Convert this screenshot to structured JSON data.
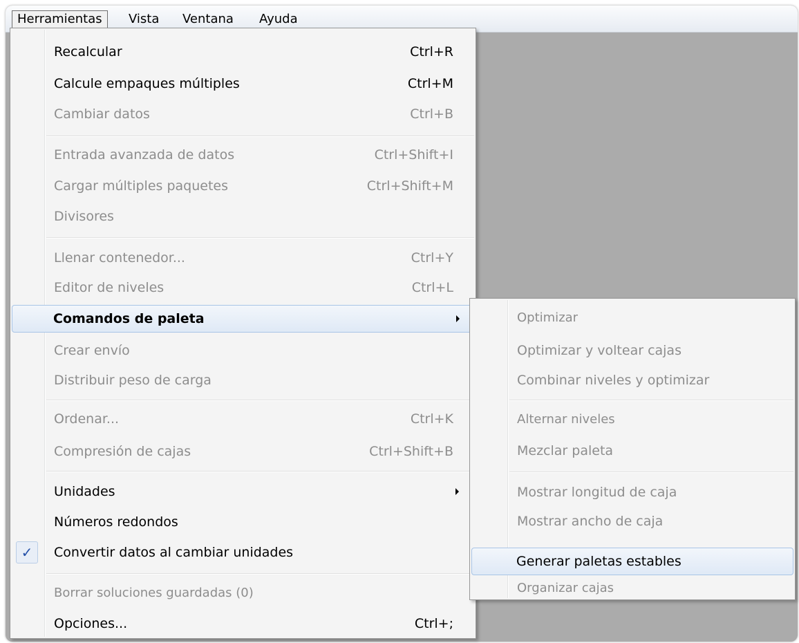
{
  "menubar": {
    "items": [
      {
        "label": "Herramientas"
      },
      {
        "label": "Vista"
      },
      {
        "label": "Ventana"
      },
      {
        "label": "Ayuda"
      }
    ]
  },
  "menu": {
    "items": [
      {
        "label": "Recalcular",
        "shortcut": "Ctrl+R"
      },
      {
        "label": "Calcule empaques múltiples",
        "shortcut": "Ctrl+M"
      },
      {
        "label": "Cambiar datos",
        "shortcut": "Ctrl+B"
      },
      {
        "label": "Entrada avanzada de datos",
        "shortcut": "Ctrl+Shift+I"
      },
      {
        "label": "Cargar múltiples paquetes",
        "shortcut": "Ctrl+Shift+M"
      },
      {
        "label": "Divisores",
        "shortcut": ""
      },
      {
        "label": "Llenar contenedor...",
        "shortcut": "Ctrl+Y"
      },
      {
        "label": "Editor de niveles",
        "shortcut": "Ctrl+L"
      },
      {
        "label": "Comandos de paleta",
        "shortcut": ""
      },
      {
        "label": "Crear envío",
        "shortcut": ""
      },
      {
        "label": "Distribuir peso de carga",
        "shortcut": ""
      },
      {
        "label": "Ordenar...",
        "shortcut": "Ctrl+K"
      },
      {
        "label": "Compresión de cajas",
        "shortcut": "Ctrl+Shift+B"
      },
      {
        "label": "Unidades",
        "shortcut": ""
      },
      {
        "label": "Números redondos",
        "shortcut": ""
      },
      {
        "label": "Convertir datos al cambiar unidades",
        "shortcut": ""
      },
      {
        "label": "Borrar soluciones guardadas (0)",
        "shortcut": ""
      },
      {
        "label": "Opciones...",
        "shortcut": "Ctrl+;"
      }
    ],
    "check_glyph": "✓",
    "check_icon": "checkmark-icon",
    "submenu_arrow_icon": "submenu-arrow-icon"
  },
  "submenu": {
    "items": [
      {
        "label": "Optimizar"
      },
      {
        "label": "Optimizar y voltear cajas"
      },
      {
        "label": "Combinar niveles y optimizar"
      },
      {
        "label": "Alternar niveles"
      },
      {
        "label": "Mezclar paleta"
      },
      {
        "label": "Mostrar longitud de caja"
      },
      {
        "label": "Mostrar ancho de caja"
      },
      {
        "label": "Generar paletas estables"
      },
      {
        "label": "Organizar cajas"
      }
    ]
  },
  "colors": {
    "highlight_border": "#a8c4e6",
    "disabled_text": "#8d8d8d",
    "workspace_background": "#ababab",
    "check_color": "#2450a8"
  }
}
